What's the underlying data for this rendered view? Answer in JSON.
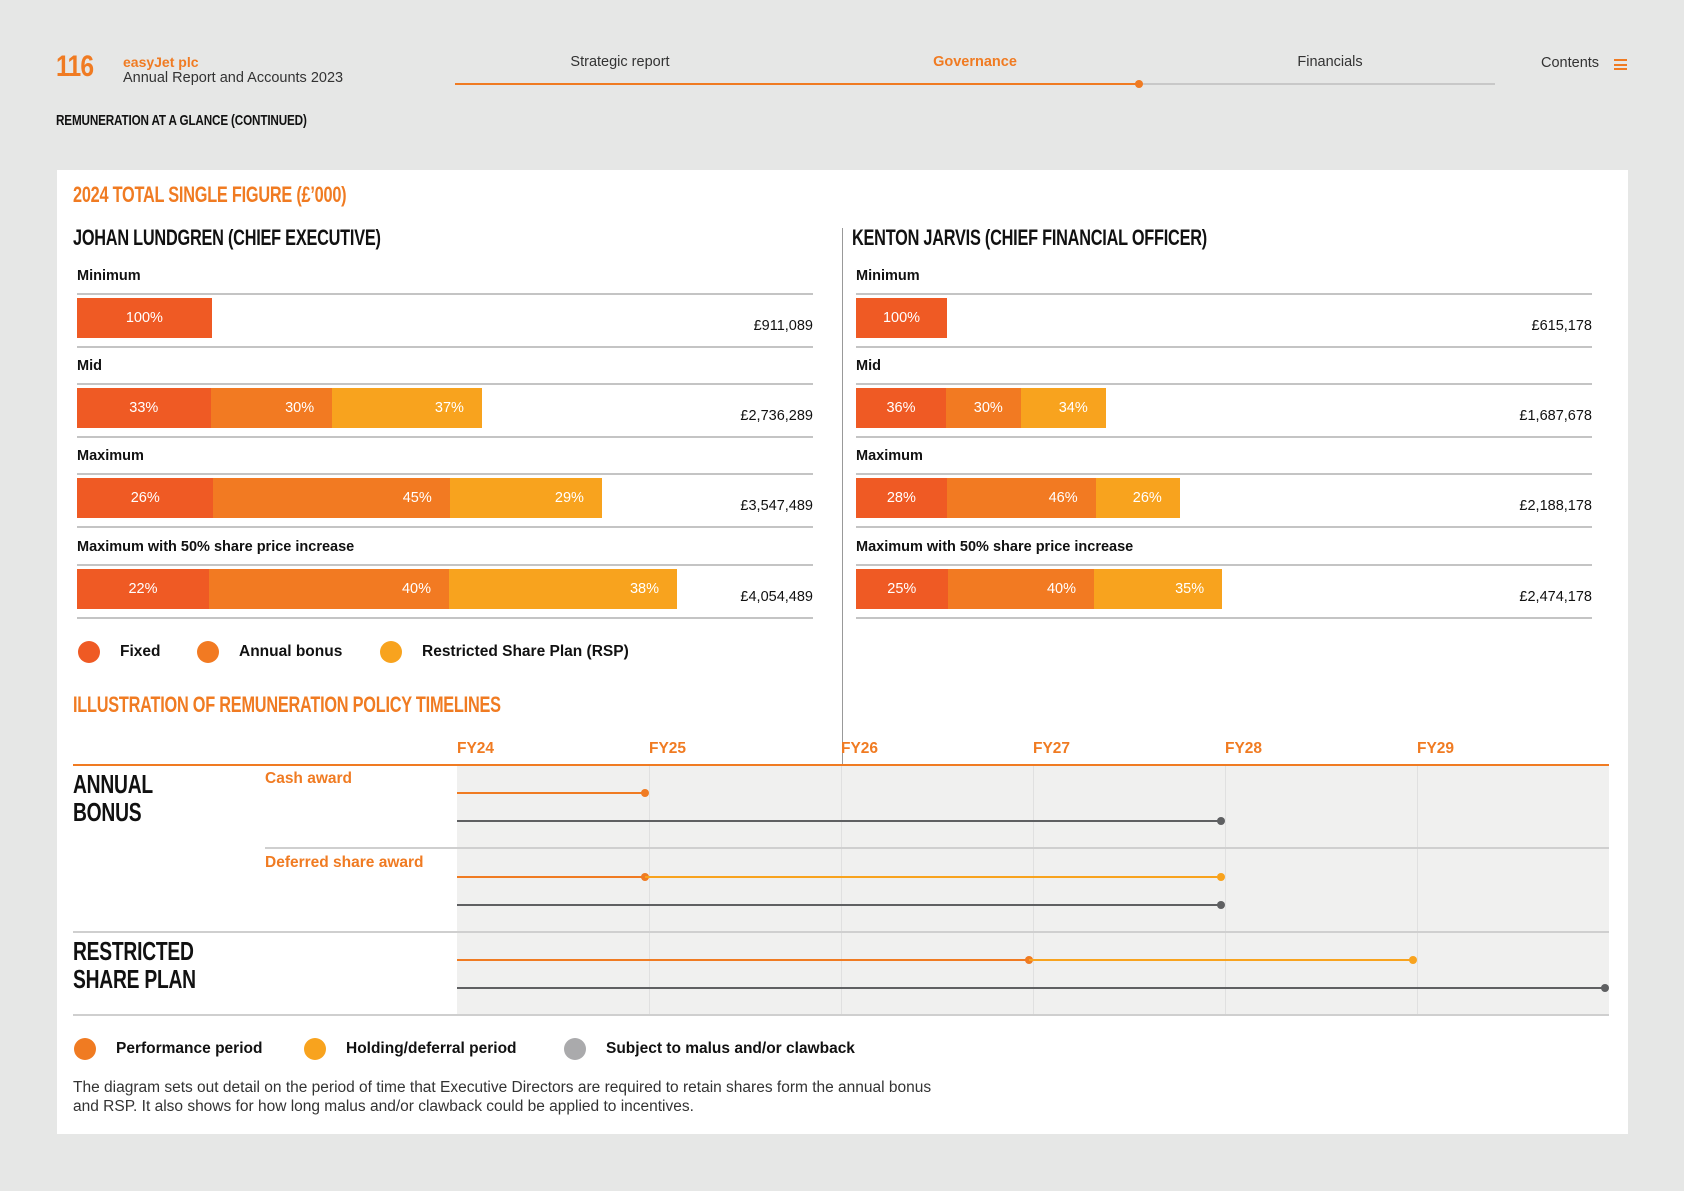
{
  "header": {
    "page_number": "116",
    "company": "easyJet plc",
    "report": "Annual Report and Accounts 2023",
    "nav": [
      {
        "label": "Strategic report",
        "active": false
      },
      {
        "label": "Governance",
        "active": true
      },
      {
        "label": "Financials",
        "active": false
      }
    ],
    "contents_label": "Contents",
    "section_heading": "REMUNERATION AT A GLANCE (CONTINUED)"
  },
  "colors": {
    "fixed": "#ef5a24",
    "annual_bonus": "#f27a22",
    "rsp": "#f8a31e",
    "performance": "#f07b22",
    "holding": "#f8a31e",
    "malus": "#5f6062",
    "brand": "#f07b22"
  },
  "single_figure": {
    "title": "2024 TOTAL SINGLE FIGURE (£’000)",
    "legend": [
      "Fixed",
      "Annual bonus",
      "Restricted Share Plan (RSP)"
    ]
  },
  "chart_data": [
    {
      "type": "bar",
      "title": "JOHAN LUNDGREN (CHIEF EXECUTIVE)",
      "categories": [
        "Minimum",
        "Mid",
        "Maximum",
        "Maximum with 50% share price increase"
      ],
      "totals": [
        "£911,089",
        "£2,736,289",
        "£3,547,489",
        "£4,054,489"
      ],
      "total_values": [
        911089,
        2736289,
        3547489,
        4054489
      ],
      "series": [
        {
          "name": "Fixed",
          "values": [
            "100%",
            "33%",
            "26%",
            "22%"
          ]
        },
        {
          "name": "Annual bonus",
          "values": [
            "",
            "30%",
            "45%",
            "40%"
          ]
        },
        {
          "name": "Restricted Share Plan (RSP)",
          "values": [
            "",
            "37%",
            "29%",
            "38%"
          ]
        }
      ]
    },
    {
      "type": "bar",
      "title": "KENTON JARVIS (CHIEF FINANCIAL OFFICER)",
      "categories": [
        "Minimum",
        "Mid",
        "Maximum",
        "Maximum with 50% share price increase"
      ],
      "totals": [
        "£615,178",
        "£1,687,678",
        "£2,188,178",
        "£2,474,178"
      ],
      "total_values": [
        615178,
        1687678,
        2188178,
        2474178
      ],
      "series": [
        {
          "name": "Fixed",
          "values": [
            "100%",
            "36%",
            "28%",
            "25%"
          ]
        },
        {
          "name": "Annual bonus",
          "values": [
            "",
            "30%",
            "46%",
            "40%"
          ]
        },
        {
          "name": "Restricted Share Plan (RSP)",
          "values": [
            "",
            "34%",
            "26%",
            "35%"
          ]
        }
      ]
    }
  ],
  "timeline": {
    "title": "ILLUSTRATION OF REMUNERATION POLICY TIMELINES",
    "years": [
      "FY24",
      "FY25",
      "FY26",
      "FY27",
      "FY28",
      "FY29"
    ],
    "sections": [
      {
        "title_lines": [
          "ANNUAL",
          "BONUS"
        ]
      },
      {
        "title_lines": [
          "RESTRICTED",
          "SHARE PLAN"
        ]
      }
    ],
    "sub_labels": [
      "Cash award",
      "Deferred share award"
    ],
    "tracks": [
      {
        "segments": [
          {
            "kind": "performance",
            "from": 0,
            "to": 0.98
          }
        ]
      },
      {
        "segments": [
          {
            "kind": "malus",
            "from": 0,
            "to": 3.98
          }
        ]
      },
      {
        "segments": [
          {
            "kind": "performance",
            "from": 0,
            "to": 0.98
          },
          {
            "kind": "holding",
            "from": 0.98,
            "to": 3.98
          }
        ]
      },
      {
        "segments": [
          {
            "kind": "malus",
            "from": 0,
            "to": 3.98
          }
        ]
      },
      {
        "segments": [
          {
            "kind": "performance",
            "from": 0,
            "to": 2.98
          },
          {
            "kind": "holding",
            "from": 2.98,
            "to": 4.98
          }
        ]
      },
      {
        "segments": [
          {
            "kind": "malus",
            "from": 0,
            "to": 5.98
          }
        ]
      }
    ],
    "legend": [
      "Performance period",
      "Holding/deferral period",
      "Subject to malus and/or clawback"
    ],
    "footnote": "The diagram sets out detail on the period of time that Executive Directors are required to retain shares form the annual bonus and RSP. It also shows for how long malus and/or clawback could be applied to incentives."
  }
}
